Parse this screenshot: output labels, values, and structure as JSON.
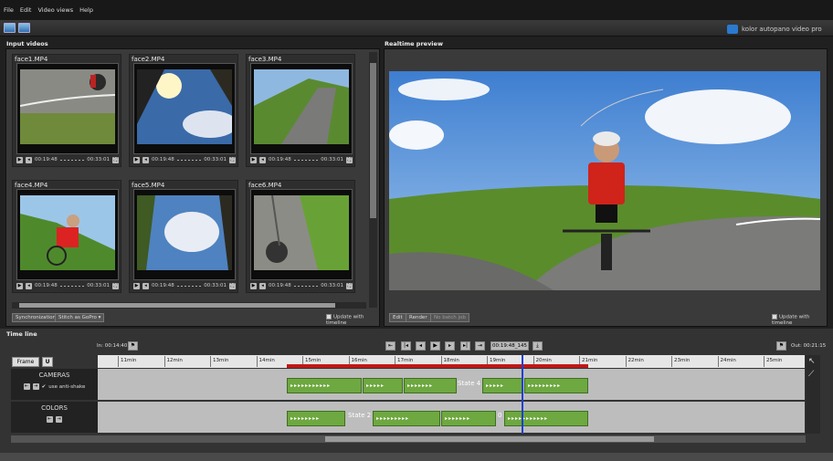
{
  "menu": [
    "File",
    "Edit",
    "Video views",
    "Help"
  ],
  "brand": {
    "text": "kolor autopano video pro"
  },
  "input_panel": {
    "title": "Input videos",
    "videos": [
      {
        "name": "face1.MP4",
        "time_start": "00:19:48",
        "time_end": "00:33:01"
      },
      {
        "name": "face2.MP4",
        "time_start": "00:19:48",
        "time_end": "00:33:01"
      },
      {
        "name": "face3.MP4",
        "time_start": "00:19:48",
        "time_end": "00:33:01"
      },
      {
        "name": "face4.MP4",
        "time_start": "00:19:48",
        "time_end": "00:33:01"
      },
      {
        "name": "face5.MP4",
        "time_start": "00:19:48",
        "time_end": "00:33:01"
      },
      {
        "name": "face6.MP4",
        "time_start": "00:19:48",
        "time_end": "00:33:01"
      }
    ],
    "sync_button": "Synchronization",
    "stitch_select": "Stitch as GoPro",
    "update_label": "Update with timeline"
  },
  "preview_panel": {
    "title": "Realtime preview",
    "edit_button": "Edit",
    "render_button": "Render",
    "batch_button": "No batch job",
    "update_label": "Update with timeline"
  },
  "timeline": {
    "title": "Time line",
    "in_label": "In: 00:14:40",
    "out_label": "Out: 00:21:15",
    "current_time": "00:19:48_145",
    "frame_button": "Frame",
    "u_button": "U",
    "ticks": [
      "11min",
      "12min",
      "13min",
      "14min",
      "15min",
      "16min",
      "17min",
      "18min",
      "19min",
      "20min",
      "21min",
      "22min",
      "23min",
      "24min",
      "25min"
    ],
    "cameras_label": "CAMERAS",
    "anti_shake_label": "use anti-shake",
    "colors_label": "COLORS",
    "camera_state_label": "State 4",
    "color_state_label": "State 2",
    "color_small_label": "0"
  }
}
